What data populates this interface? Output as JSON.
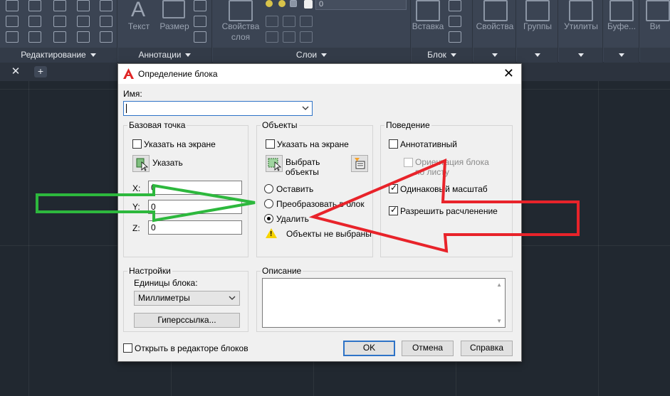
{
  "ribbon": {
    "panels": {
      "edit": "Редактирование",
      "annotations": "Аннотации",
      "layers": "Слои",
      "block": "Блок"
    },
    "buttons": {
      "text": "Текст",
      "dimension": "Размер",
      "layer_props_line1": "Свойства",
      "layer_props_line2": "слоя",
      "insert": "Вставка",
      "properties": "Свойства",
      "groups": "Группы",
      "utilities": "Утилиты",
      "buffer": "Буфе...",
      "view": "Ви"
    },
    "layer_value": "0"
  },
  "dialog": {
    "title": "Определение блока",
    "name_label": "Имя:",
    "name_value": "",
    "base_point": {
      "title": "Базовая точка",
      "specify_on_screen": "Указать на экране",
      "specify_on_screen_checked": false,
      "pick_button": "Указать",
      "x_label": "X:",
      "x_value": "0",
      "y_label": "Y:",
      "y_value": "0",
      "z_label": "Z:",
      "z_value": "0"
    },
    "objects": {
      "title": "Объекты",
      "specify_on_screen": "Указать на экране",
      "specify_on_screen_checked": false,
      "select_button_line1": "Выбрать",
      "select_button_line2": "объекты",
      "retain": "Оставить",
      "convert": "Преобразовать в блок",
      "delete": "Удалить",
      "selected_option": "delete",
      "status": "Объекты не выбраны"
    },
    "behavior": {
      "title": "Поведение",
      "annotative": "Аннотативный",
      "annotative_checked": false,
      "orient_line1": "Ориентация блока",
      "orient_line2": "по листу",
      "uniform_scale": "Одинаковый масштаб",
      "uniform_scale_checked": true,
      "allow_explode": "Разрешить расчленение",
      "allow_explode_checked": true
    },
    "settings": {
      "title": "Настройки",
      "units_label": "Единицы блока:",
      "units_value": "Миллиметры",
      "hyperlink_button": "Гиперссылка..."
    },
    "description": {
      "title": "Описание",
      "value": ""
    },
    "open_in_editor": "Открыть в редакторе блоков",
    "open_in_editor_checked": false,
    "ok": "OK",
    "cancel": "Отмена",
    "help": "Справка"
  },
  "colors": {
    "arrow_green": "#2db83d",
    "arrow_red": "#e8232a",
    "accent": "#2e73c7",
    "canvas_bg": "#212830"
  }
}
